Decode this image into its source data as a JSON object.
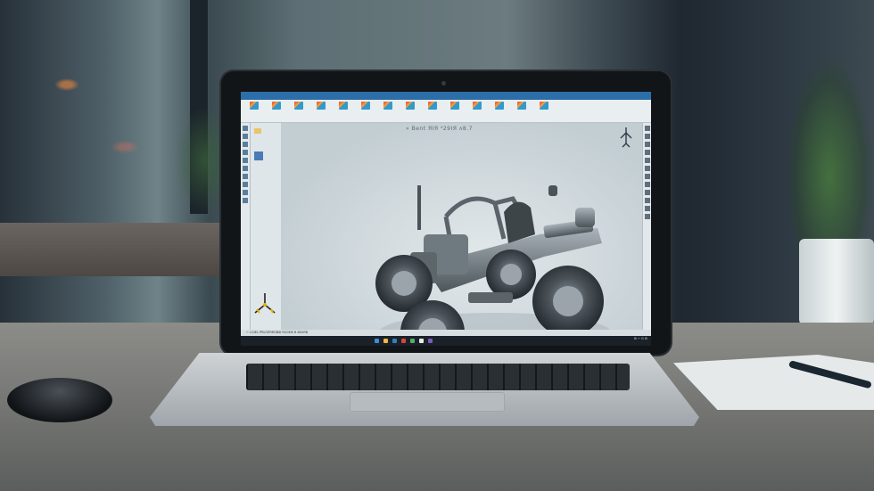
{
  "scene": {
    "viewport_label": "» Bent ЯIЯ ⁴29IЯ ʌ8.7",
    "status_text": "⌐ LGIEL PRLOERRGB⊞ RG0E⊞ B B00RB",
    "clock_text": "⊞ ⌐ ⊡ ⊞",
    "ribbon_icons": [
      "part-icon",
      "sketch-icon",
      "extrude-icon",
      "revolve-icon",
      "fillet-icon",
      "chamfer-icon",
      "shell-icon",
      "pattern-icon",
      "mirror-icon",
      "assembly-icon",
      "mate-icon",
      "drawing-icon",
      "measure-icon",
      "render-icon"
    ],
    "accent": "#2d6ea8"
  }
}
